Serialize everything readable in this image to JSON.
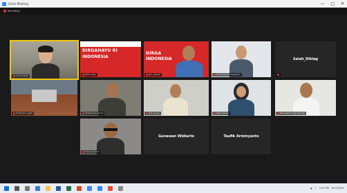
{
  "window": {
    "title": "Zoom Meeting",
    "controls": [
      "—",
      "□",
      "✕"
    ]
  },
  "recording": {
    "label": "Recording"
  },
  "tiles": [
    {
      "id": "t1",
      "name": "Iris Surianto",
      "type": "video"
    },
    {
      "id": "t2",
      "name": "Hifni Lubis",
      "type": "banner",
      "banner_title": "DIRGAHAYU RI",
      "banner_sub": "INDONESIA"
    },
    {
      "id": "t3",
      "name": "Giri_Irfanto",
      "type": "banner-person",
      "banner_title": "DIRGA",
      "banner_sub": "INDONESIA"
    },
    {
      "id": "t4",
      "name": "Adhi Pranata Sugiyarto",
      "type": "video"
    },
    {
      "id": "t5",
      "name": "Seiah_Diklag",
      "type": "name"
    },
    {
      "id": "t6",
      "name": "Kinkhard Lugadi",
      "type": "video"
    },
    {
      "id": "t7",
      "name": "Muhtamad Samid",
      "type": "video"
    },
    {
      "id": "t8",
      "name": "Isal_Syuari",
      "type": "video"
    },
    {
      "id": "t9",
      "name": "Rita Yulianti",
      "type": "video"
    },
    {
      "id": "t10",
      "name": "Hirauwanto Riza 19 dab",
      "type": "video"
    },
    {
      "id": "t11",
      "name": "Sujo_Sumardi",
      "type": "video"
    },
    {
      "id": "t12",
      "name": "Gunawan Widiarto",
      "type": "name"
    },
    {
      "id": "t13",
      "name": "Taufik Arminyanto",
      "type": "name"
    }
  ],
  "taskbar": {
    "time": "2:21 PM",
    "date": "8/17/2021"
  },
  "colors": {
    "accent_speaking": "#f0c808",
    "banner_red": "#d62828",
    "mic_muted": "#e53935"
  }
}
